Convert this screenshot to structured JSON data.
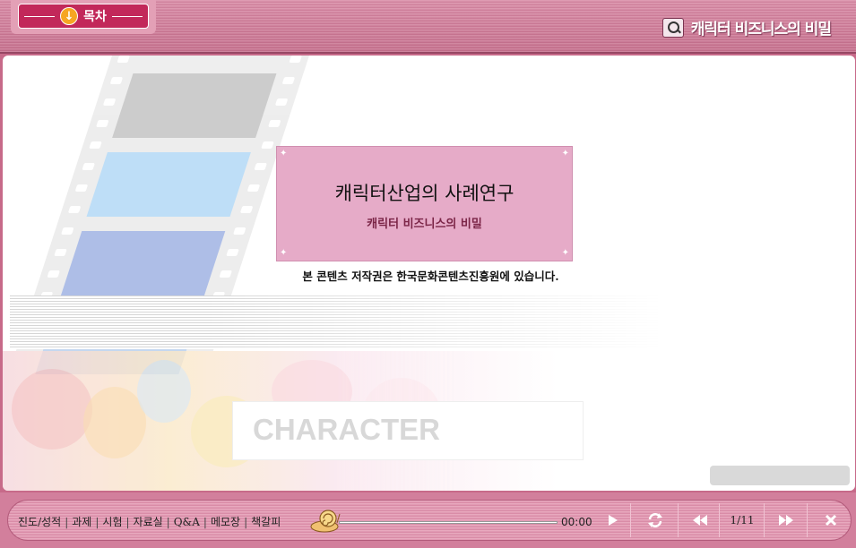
{
  "header": {
    "toc_label": "목차",
    "title": "캐릭터 비즈니스의 비밀"
  },
  "card": {
    "title": "캐릭터산업의 사례연구",
    "subtitle": "캐릭터 비즈니스의 비밀",
    "copyright": "본 콘텐츠 저작권은 한국문화콘텐츠진흥원에 있습니다."
  },
  "banner": {
    "word": "CHARACTER"
  },
  "bottom": {
    "menu": [
      "진도/성적",
      "과제",
      "시험",
      "자료실",
      "Q&A",
      "메모장",
      "책갈피"
    ],
    "time": "00:00",
    "page": "1/11"
  },
  "colors": {
    "brand": "#c2285a",
    "header": "#c96f8e",
    "card": "#e6abc8"
  }
}
